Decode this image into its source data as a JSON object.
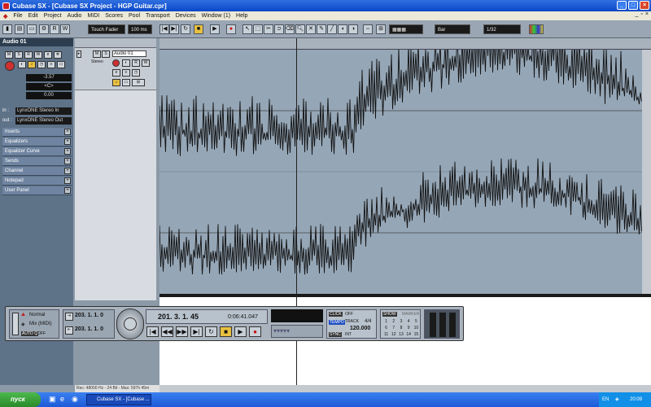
{
  "window": {
    "title": "Cubase SX - [Cubase SX Project - HGP Guitar.cpr]"
  },
  "menu": [
    "File",
    "Edit",
    "Project",
    "Audio",
    "MIDI",
    "Scores",
    "Pool",
    "Transport",
    "Devices",
    "Window (1)",
    "Help"
  ],
  "toolbar": {
    "automation_mode": "Touch Fader",
    "pre_roll": "100 ms",
    "snap_type": "Bar",
    "quantize": "1/32"
  },
  "inspector": {
    "track_name": "Audio 01",
    "volume": "-3.57",
    "pan": "<C>",
    "delay": "0.00",
    "in_label": "in :",
    "in_value": "LynxONE Stereo In",
    "out_label": "out :",
    "out_value": "LynxONE Stereo Out",
    "sections": [
      "Inserts",
      "Equalizers",
      "Equalizer Curve",
      "Sends",
      "Channel",
      "Notepad",
      "User Panel"
    ]
  },
  "track": {
    "name": "Audio 01",
    "type": "Stereo"
  },
  "transport": {
    "mode": "Normal",
    "record_mode": "Mix (MIDI)",
    "autoq_label": "AUTO Q",
    "autoq_value": "OFF",
    "left_locator": "203. 1. 1. 0",
    "right_locator": "203. 1. 1. 0",
    "position_bars": "201. 3. 1. 45",
    "position_time": "0:06:41.047",
    "click_label": "CLICK",
    "click_value": "OFF",
    "tempo_label": "TEMPO",
    "track_label": "TRACK",
    "signature": "4/4",
    "tempo": "120.000",
    "sync_label": "SYNC",
    "sync_value": "INT",
    "show_label": "SHOW",
    "marker_label": "MARKER",
    "markers": [
      "1",
      "2",
      "3",
      "4",
      "5",
      "6",
      "7",
      "8",
      "9",
      "10",
      "11",
      "12",
      "13",
      "14",
      "15"
    ]
  },
  "status": {
    "text": "Rec: 48000 Hz - 24 Bit - Max: 597h 45m"
  },
  "taskbar": {
    "start": "пуск",
    "task": "Cubase SX - [Cubase ...",
    "lang": "EN",
    "clock": "20:09"
  }
}
